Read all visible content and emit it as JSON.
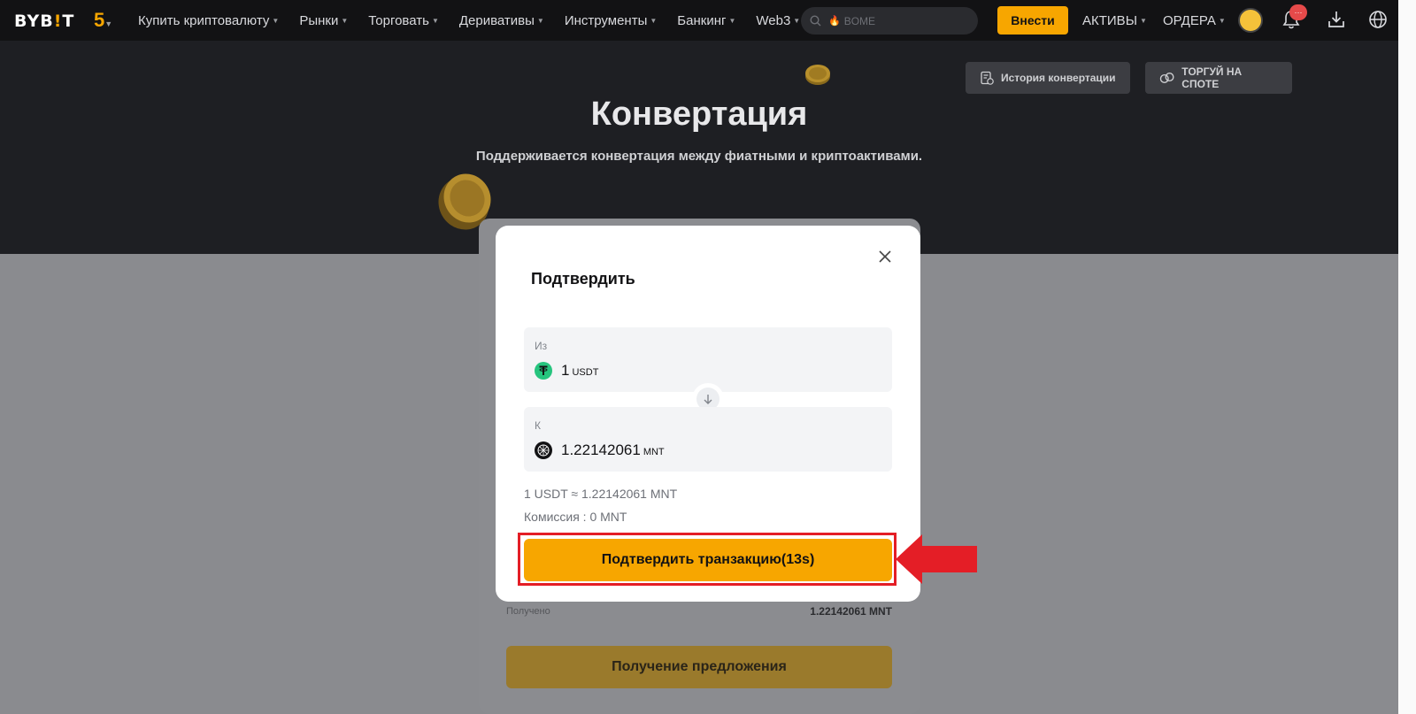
{
  "header": {
    "logo_prefix": "BYB",
    "logo_bang": "!",
    "logo_suffix": "T",
    "anniversary": "5",
    "nav": [
      {
        "label": "Купить криптовалюту"
      },
      {
        "label": "Рынки"
      },
      {
        "label": "Торговать"
      },
      {
        "label": "Деривативы"
      },
      {
        "label": "Инструменты"
      },
      {
        "label": "Банкинг"
      },
      {
        "label": "Web3"
      }
    ],
    "search_placeholder": "BOME",
    "deposit_label": "Внести",
    "assets_label": "АКТИВЫ",
    "orders_label": "ОРДЕРА",
    "notification_badge": "···"
  },
  "hero": {
    "title": "Конвертация",
    "subtitle": "Поддерживается конвертация между фиатными и криптоактивами.",
    "history_button": "История конвертации",
    "spot_button": "ТОРГУЙ НА СПОТЕ"
  },
  "background_card": {
    "received_label": "Получено",
    "received_value": "1.22142061 MNT",
    "quote_button": "Получение предложения"
  },
  "modal": {
    "title": "Подтвердить",
    "from_label": "Из",
    "from_amount": "1",
    "from_unit": "USDT",
    "to_label": "К",
    "to_amount": "1.22142061",
    "to_unit": "MNT",
    "rate": "1 USDT ≈ 1.22142061 MNT",
    "fee": "Комиссия  : 0 MNT",
    "confirm_button": "Подтвердить транзакцию(13s)"
  },
  "colors": {
    "brand_accent": "#f7a600",
    "header_bg": "#121214",
    "highlight": "#e41e26",
    "usdt_green": "#26c47e"
  }
}
